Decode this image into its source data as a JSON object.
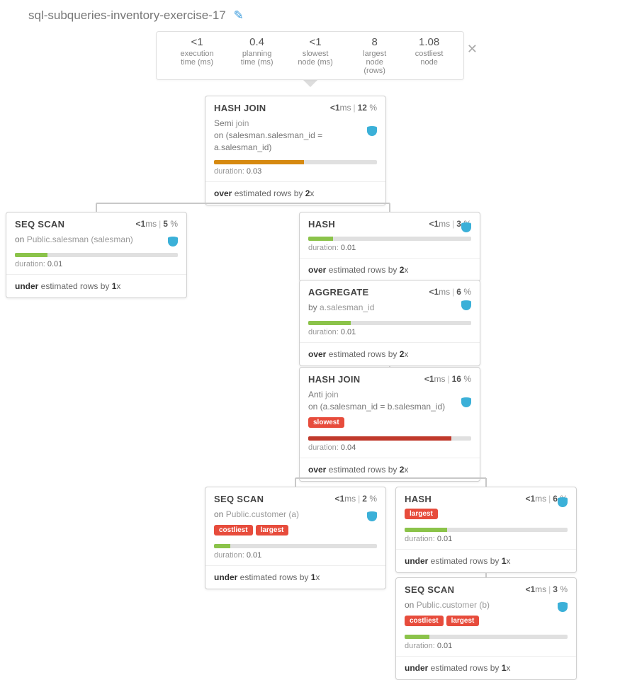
{
  "title": "sql-subqueries-inventory-exercise-17",
  "stats": [
    {
      "val": "<1",
      "lbl": "execution time (ms)"
    },
    {
      "val": "0.4",
      "lbl": "planning time (ms)"
    },
    {
      "val": "<1",
      "lbl": "slowest node (ms)"
    },
    {
      "val": "8",
      "lbl": "largest node (rows)"
    },
    {
      "val": "1.08",
      "lbl": "costliest node"
    }
  ],
  "nodes": {
    "n0": {
      "title": "HASH JOIN",
      "time": "<1",
      "pct": "12",
      "desc_plain": "Semi ",
      "desc_muted": "join",
      "desc_rest": "on (salesman.salesman_id = a.salesman_id)",
      "dur": "0.03",
      "est_kind": "over",
      "est_x": "2",
      "bar_pct": 55,
      "bar_color": "bar-orange",
      "dbtop": "42"
    },
    "n1": {
      "title": "SEQ SCAN",
      "time": "<1",
      "pct": "5",
      "desc_plain": "on ",
      "desc_muted": "Public.salesman (salesman)",
      "dur": "0.01",
      "est_kind": "under",
      "est_x": "1",
      "bar_pct": 20,
      "bar_color": "bar-green",
      "dbtop": "34"
    },
    "n2": {
      "title": "HASH",
      "time": "<1",
      "pct": "3",
      "dur": "0.01",
      "est_kind": "over",
      "est_x": "2",
      "bar_pct": 15,
      "bar_color": "bar-green",
      "dbtop": "14"
    },
    "n3": {
      "title": "AGGREGATE",
      "time": "<1",
      "pct": "6",
      "desc_plain": "by ",
      "desc_muted": "a.salesman_id",
      "dur": "0.01",
      "est_kind": "over",
      "est_x": "2",
      "bar_pct": 26,
      "bar_color": "bar-green",
      "dbtop": "28"
    },
    "n4": {
      "title": "HASH JOIN",
      "time": "<1",
      "pct": "16",
      "desc_plain": "Anti ",
      "desc_muted": "join",
      "desc_rest": "on (a.salesman_id = b.salesman_id)",
      "badges": [
        "slowest"
      ],
      "dur": "0.04",
      "est_kind": "over",
      "est_x": "2",
      "bar_pct": 88,
      "bar_color": "bar-red",
      "dbtop": "42"
    },
    "n5": {
      "title": "SEQ SCAN",
      "time": "<1",
      "pct": "2",
      "desc_plain": "on ",
      "desc_muted": "Public.customer (a)",
      "badges": [
        "costliest",
        "largest"
      ],
      "dur": "0.01",
      "est_kind": "under",
      "est_x": "1",
      "bar_pct": 10,
      "bar_color": "bar-green",
      "dbtop": "34"
    },
    "n6": {
      "title": "HASH",
      "time": "<1",
      "pct": "6",
      "badges": [
        "largest"
      ],
      "dur": "0.01",
      "est_kind": "under",
      "est_x": "1",
      "bar_pct": 26,
      "bar_color": "bar-green",
      "dbtop": "14"
    },
    "n7": {
      "title": "SEQ SCAN",
      "time": "<1",
      "pct": "3",
      "desc_plain": "on ",
      "desc_muted": "Public.customer (b)",
      "badges": [
        "costliest",
        "largest"
      ],
      "dur": "0.01",
      "est_kind": "under",
      "est_x": "1",
      "bar_pct": 15,
      "bar_color": "bar-green",
      "dbtop": "34"
    }
  },
  "labels": {
    "ms": "ms",
    "duration": "duration:",
    "est_suffix": " estimated rows by "
  }
}
